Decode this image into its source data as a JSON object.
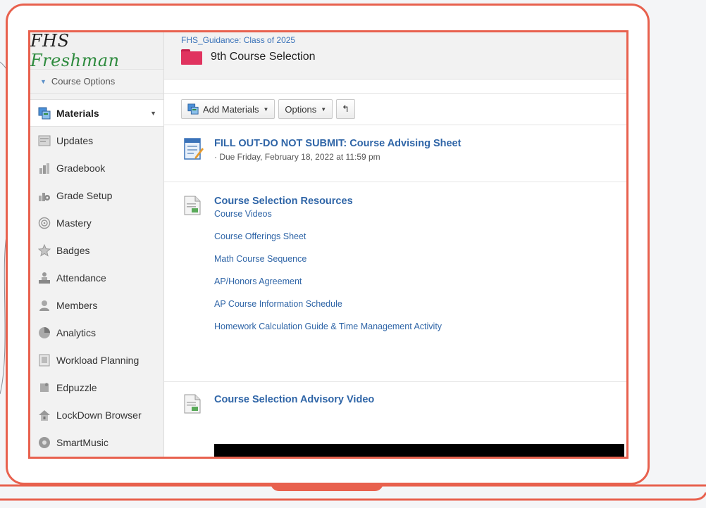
{
  "sidebar": {
    "logo_primary": "FHS",
    "logo_accent": "Freshman",
    "course_options_label": "Course Options",
    "active_item": "Materials",
    "items": [
      {
        "label": "Updates",
        "icon": "updates-icon"
      },
      {
        "label": "Gradebook",
        "icon": "gradebook-icon"
      },
      {
        "label": "Grade Setup",
        "icon": "grade-setup-icon"
      },
      {
        "label": "Mastery",
        "icon": "mastery-icon"
      },
      {
        "label": "Badges",
        "icon": "badges-icon"
      },
      {
        "label": "Attendance",
        "icon": "attendance-icon"
      },
      {
        "label": "Members",
        "icon": "members-icon"
      },
      {
        "label": "Analytics",
        "icon": "analytics-icon"
      },
      {
        "label": "Workload Planning",
        "icon": "workload-planning-icon"
      },
      {
        "label": "Edpuzzle",
        "icon": "edpuzzle-icon"
      },
      {
        "label": "LockDown Browser",
        "icon": "lockdown-browser-icon"
      },
      {
        "label": "SmartMusic",
        "icon": "smartmusic-icon"
      }
    ]
  },
  "header": {
    "breadcrumb": "FHS_Guidance: Class of 2025",
    "title": "9th Course Selection",
    "folder_color": "#e0335f"
  },
  "toolbar": {
    "add_materials_label": "Add Materials",
    "options_label": "Options"
  },
  "materials": {
    "assignment": {
      "title": "FILL OUT-DO NOT SUBMIT: Course Advising Sheet",
      "due": "· Due Friday, February 18, 2022 at 11:59 pm"
    },
    "resources": {
      "title": "Course Selection Resources",
      "links": [
        "Course Videos",
        "Course Offerings Sheet",
        "Math Course Sequence",
        "AP/Honors Agreement",
        "AP Course Information Schedule",
        "Homework Calculation Guide & Time Management Activity"
      ]
    },
    "video": {
      "title": "Course Selection Advisory Video"
    }
  },
  "colors": {
    "frame_accent": "#e8614e",
    "link": "#2f65a7"
  }
}
